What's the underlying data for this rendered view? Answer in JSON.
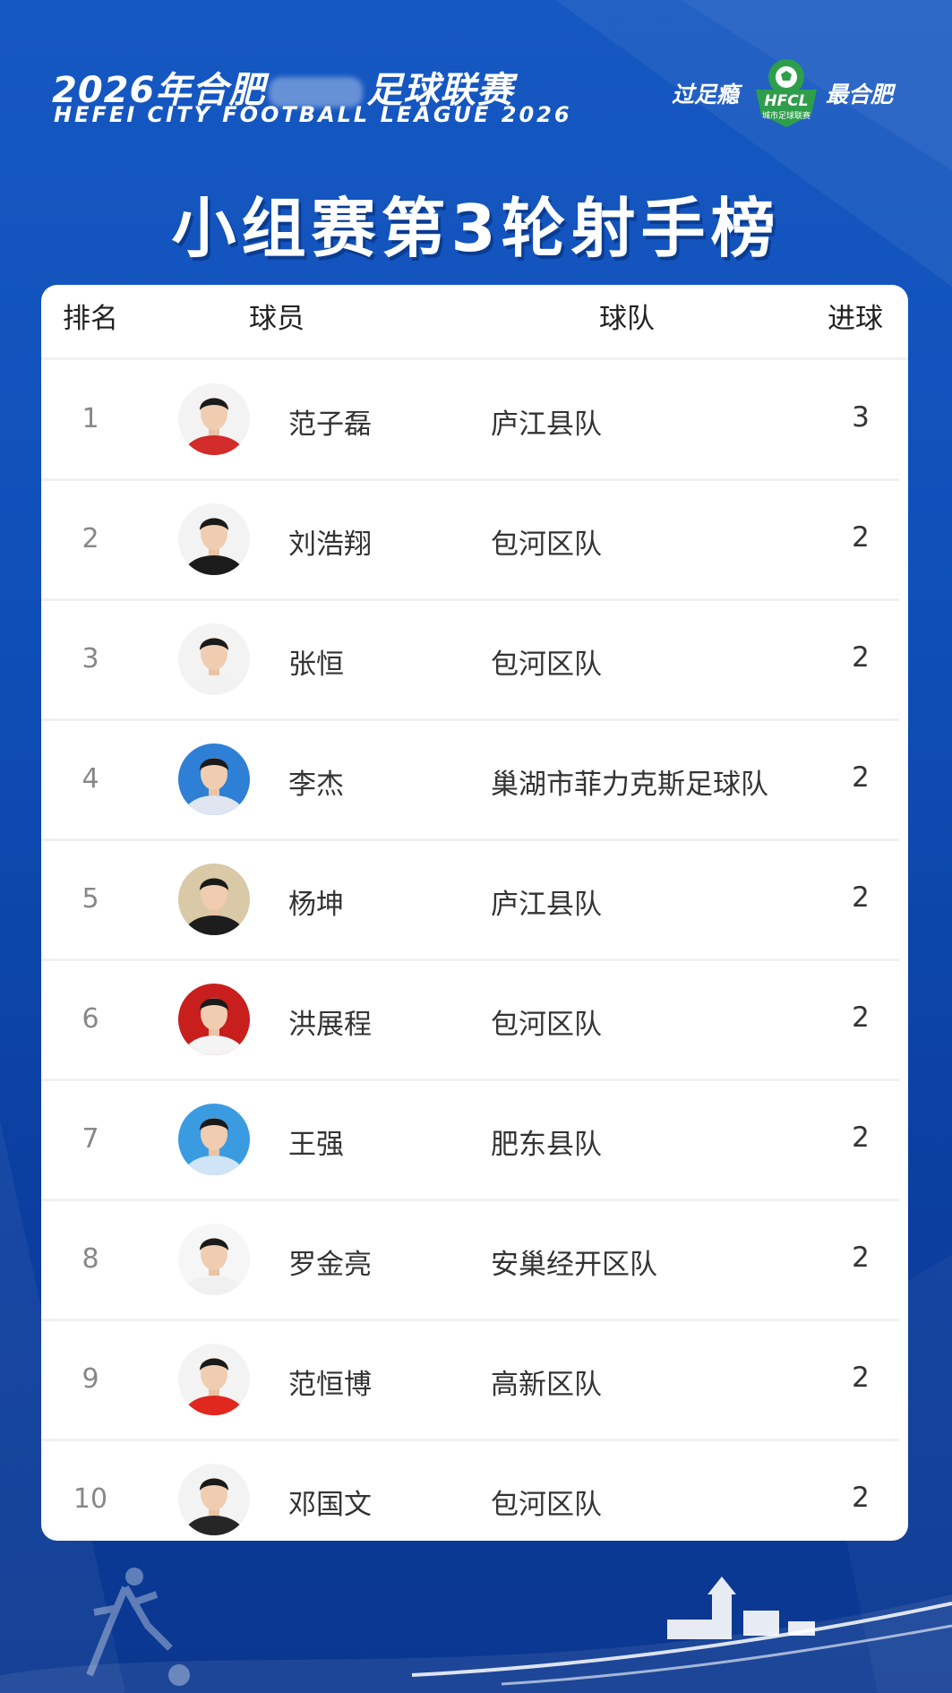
{
  "header": {
    "league_cn_left": "2026年合肥",
    "league_cn_right": "足球联赛",
    "league_en": "HEFEI CITY FOOTBALL LEAGUE 2026",
    "slogan_left": "过足瘾",
    "slogan_right": "最合肥",
    "logo_text": "HFCL",
    "logo_sub": "城市足球联赛",
    "main_title": "小组赛第3轮射手榜"
  },
  "table": {
    "columns": {
      "rank": "排名",
      "player": "球员",
      "team": "球队",
      "goals": "进球"
    },
    "rows": [
      {
        "rank": "1",
        "name": "范子磊",
        "team": "庐江县队",
        "goals": "3",
        "avatar_bg": "#f3f3f3",
        "shirt": "#d32a2a"
      },
      {
        "rank": "2",
        "name": "刘浩翔",
        "team": "包河区队",
        "goals": "2",
        "avatar_bg": "#f3f3f3",
        "shirt": "#1b1b1b"
      },
      {
        "rank": "3",
        "name": "张恒",
        "team": "包河区队",
        "goals": "2",
        "avatar_bg": "#f3f3f3",
        "shirt": "#f2f2f2"
      },
      {
        "rank": "4",
        "name": "李杰",
        "team": "巢湖市菲力克斯足球队",
        "goals": "2",
        "avatar_bg": "#2e7fd6",
        "shirt": "#dfe6f2"
      },
      {
        "rank": "5",
        "name": "杨坤",
        "team": "庐江县队",
        "goals": "2",
        "avatar_bg": "#d9c9a6",
        "shirt": "#1d1d1d"
      },
      {
        "rank": "6",
        "name": "洪展程",
        "team": "包河区队",
        "goals": "2",
        "avatar_bg": "#c81e1e",
        "shirt": "#f4f4f4"
      },
      {
        "rank": "7",
        "name": "王强",
        "team": "肥东县队",
        "goals": "2",
        "avatar_bg": "#3a9be0",
        "shirt": "#cfe4f6"
      },
      {
        "rank": "8",
        "name": "罗金亮",
        "team": "安巢经开区队",
        "goals": "2",
        "avatar_bg": "#f6f6f6",
        "shirt": "#f0f0f0"
      },
      {
        "rank": "9",
        "name": "范恒博",
        "team": "高新区队",
        "goals": "2",
        "avatar_bg": "#f3f3f3",
        "shirt": "#e0281e"
      },
      {
        "rank": "10",
        "name": "邓国文",
        "team": "包河区队",
        "goals": "2",
        "avatar_bg": "#f3f3f3",
        "shirt": "#262626"
      }
    ]
  },
  "colors": {
    "background": "#1252bd",
    "card": "#ffffff",
    "logo_green": "#2e9e4b"
  }
}
